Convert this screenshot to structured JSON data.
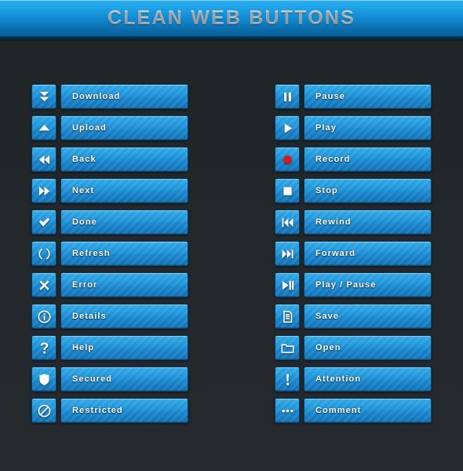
{
  "header": {
    "title": "CLEAN WEB BUTTONS"
  },
  "theme": {
    "accent": "#1f93d8",
    "accent_light": "#2fa9e6",
    "accent_dark": "#1271b4",
    "border": "#0b3f63",
    "background": "#22272b",
    "header_top": "#2aaeef",
    "header_bottom": "#0a5f98",
    "label_text": "#ffffff",
    "record_red": "#d81a1a"
  },
  "columns": [
    {
      "name": "left-column",
      "buttons": [
        {
          "label": "Download",
          "icon": "download-double-arrow-icon"
        },
        {
          "label": "Upload",
          "icon": "upload-triangle-icon"
        },
        {
          "label": "Back",
          "icon": "back-double-arrow-icon"
        },
        {
          "label": "Next",
          "icon": "next-double-arrow-icon"
        },
        {
          "label": "Done",
          "icon": "checkmark-icon"
        },
        {
          "label": "Refresh",
          "icon": "refresh-arrows-icon"
        },
        {
          "label": "Error",
          "icon": "cross-icon"
        },
        {
          "label": "Details",
          "icon": "info-circle-icon"
        },
        {
          "label": "Help",
          "icon": "question-mark-icon"
        },
        {
          "label": "Secured",
          "icon": "shield-icon"
        },
        {
          "label": "Restricted",
          "icon": "no-entry-icon"
        }
      ]
    },
    {
      "name": "right-column",
      "buttons": [
        {
          "label": "Pause",
          "icon": "pause-icon"
        },
        {
          "label": "Play",
          "icon": "play-icon"
        },
        {
          "label": "Record",
          "icon": "record-icon"
        },
        {
          "label": "Stop",
          "icon": "stop-icon"
        },
        {
          "label": "Rewind",
          "icon": "rewind-icon"
        },
        {
          "label": "Forward",
          "icon": "fast-forward-icon"
        },
        {
          "label": "Play / Pause",
          "icon": "play-pause-icon"
        },
        {
          "label": "Save",
          "icon": "document-save-icon"
        },
        {
          "label": "Open",
          "icon": "folder-open-icon"
        },
        {
          "label": "Attention",
          "icon": "exclamation-mark-icon"
        },
        {
          "label": "Comment",
          "icon": "ellipsis-comment-icon"
        }
      ]
    }
  ]
}
